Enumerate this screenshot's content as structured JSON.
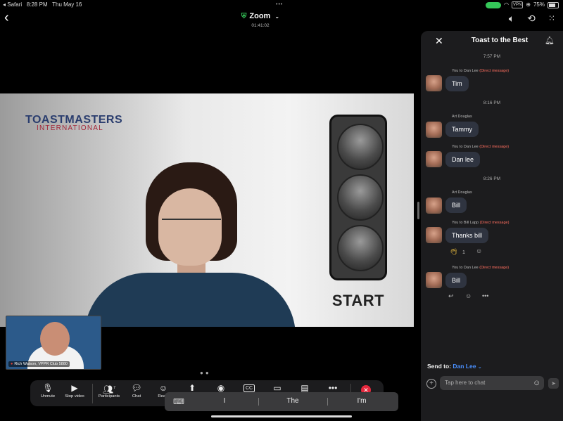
{
  "status": {
    "back_app": "◂ Safari",
    "clock": "8:28 PM",
    "date": "Thu May 16",
    "battery": "75%",
    "vpn": "VPN"
  },
  "header": {
    "app_title": "Zoom",
    "elapsed": "01:41:02"
  },
  "video": {
    "logo_main": "TOASTMASTERS",
    "logo_sub": "INTERNATIONAL",
    "timer_label": "START"
  },
  "self_view": {
    "name": "Rich Watson, VPPR Club 5880"
  },
  "toolbar": {
    "unmute": "Unmute",
    "stop_video": "Stop video",
    "participants": "Participants",
    "participants_count": "7",
    "chat": "Chat",
    "react": "React"
  },
  "keyboard": {
    "suggestions": [
      "I",
      "The",
      "I'm"
    ]
  },
  "chat": {
    "title": "Toast to the Best",
    "messages": [
      {
        "time": "7:57 PM"
      },
      {
        "from": "You to Dan Lee",
        "dm": "(Direct message)",
        "text": "Tim"
      },
      {
        "time": "8:16 PM"
      },
      {
        "from": "Art Douglas",
        "text": "Tammy"
      },
      {
        "from": "You to Dan Lee",
        "dm": "(Direct message)",
        "text": "Dan lee"
      },
      {
        "time": "8:26 PM"
      },
      {
        "from": "Art Douglas",
        "text": "Bill"
      },
      {
        "from": "You to Bill Lapp",
        "dm": "(Direct message)",
        "text": "Thanks bill",
        "reaction_count": "1"
      },
      {
        "from": "You to Dan Lee",
        "dm": "(Direct message)",
        "text": "Bill"
      }
    ],
    "send_to_label": "Send to:",
    "send_to_name": "Dan Lee",
    "input_placeholder": "Tap here to chat"
  }
}
